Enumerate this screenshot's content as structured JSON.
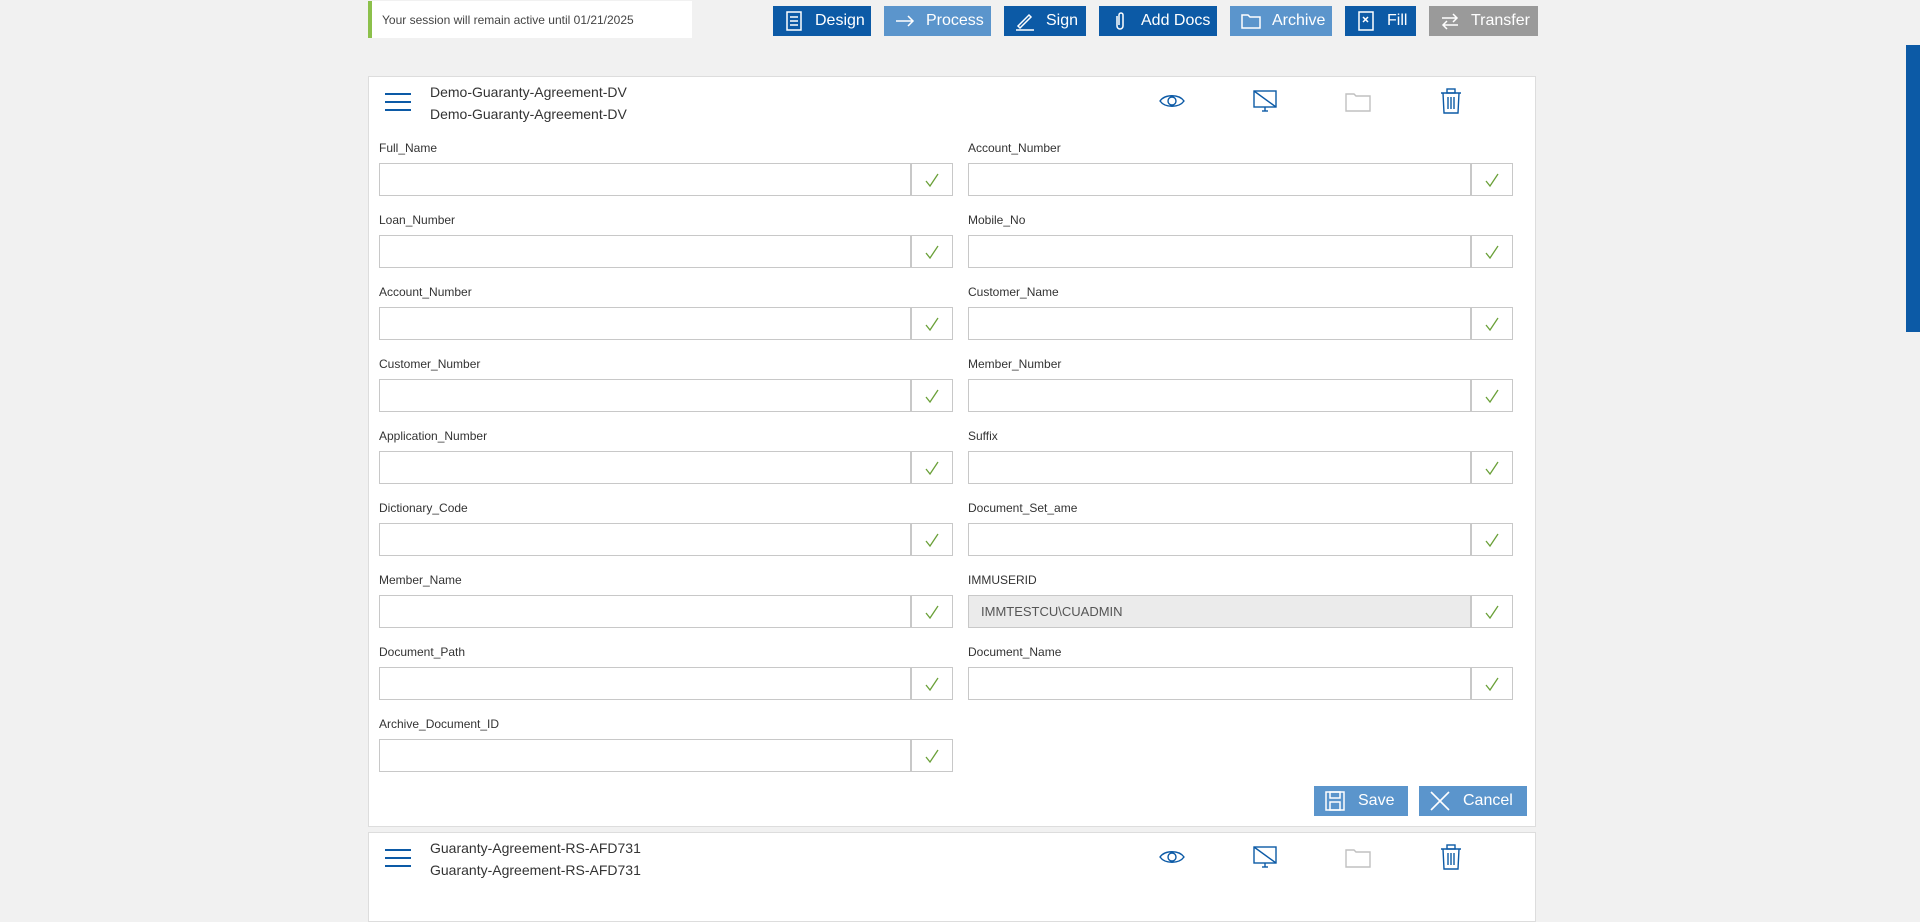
{
  "session": {
    "message": "Your session will remain active until 01/21/2025"
  },
  "toolbar": {
    "design": "Design",
    "process": "Process",
    "sign": "Sign",
    "add_docs": "Add Docs",
    "archive": "Archive",
    "fill": "Fill",
    "transfer": "Transfer"
  },
  "doc1": {
    "title_1": "Demo-Guaranty-Agreement-DV",
    "title_2": "Demo-Guaranty-Agreement-DV",
    "left_fields": [
      {
        "label": "Full_Name",
        "value": ""
      },
      {
        "label": "Loan_Number",
        "value": ""
      },
      {
        "label": "Account_Number",
        "value": ""
      },
      {
        "label": "Customer_Number",
        "value": ""
      },
      {
        "label": "Application_Number",
        "value": ""
      },
      {
        "label": "Dictionary_Code",
        "value": ""
      },
      {
        "label": "Member_Name",
        "value": ""
      },
      {
        "label": "Document_Path",
        "value": ""
      },
      {
        "label": "Archive_Document_ID",
        "value": ""
      }
    ],
    "right_fields": [
      {
        "label": "Account_Number",
        "value": ""
      },
      {
        "label": "Mobile_No",
        "value": ""
      },
      {
        "label": "Customer_Name",
        "value": ""
      },
      {
        "label": "Member_Number",
        "value": ""
      },
      {
        "label": "Suffix",
        "value": ""
      },
      {
        "label": "Document_Set_ame",
        "value": ""
      },
      {
        "label": "IMMUSERID",
        "value": "IMMTESTCU\\CUADMIN"
      },
      {
        "label": "Document_Name",
        "value": ""
      }
    ],
    "save": "Save",
    "cancel": "Cancel"
  },
  "doc2": {
    "title_1": "Guaranty-Agreement-RS-AFD731",
    "title_2": "Guaranty-Agreement-RS-AFD731"
  },
  "icons": [
    "eye-icon",
    "monitor-off-icon",
    "folder-icon",
    "trash-icon",
    "checkmark-icon"
  ],
  "colors": {
    "primary": "#0c5aa6",
    "secondary": "#5b95cc",
    "disabled": "#9a9a9a",
    "check": "#6aa038",
    "session_accent": "#8cc04b"
  }
}
